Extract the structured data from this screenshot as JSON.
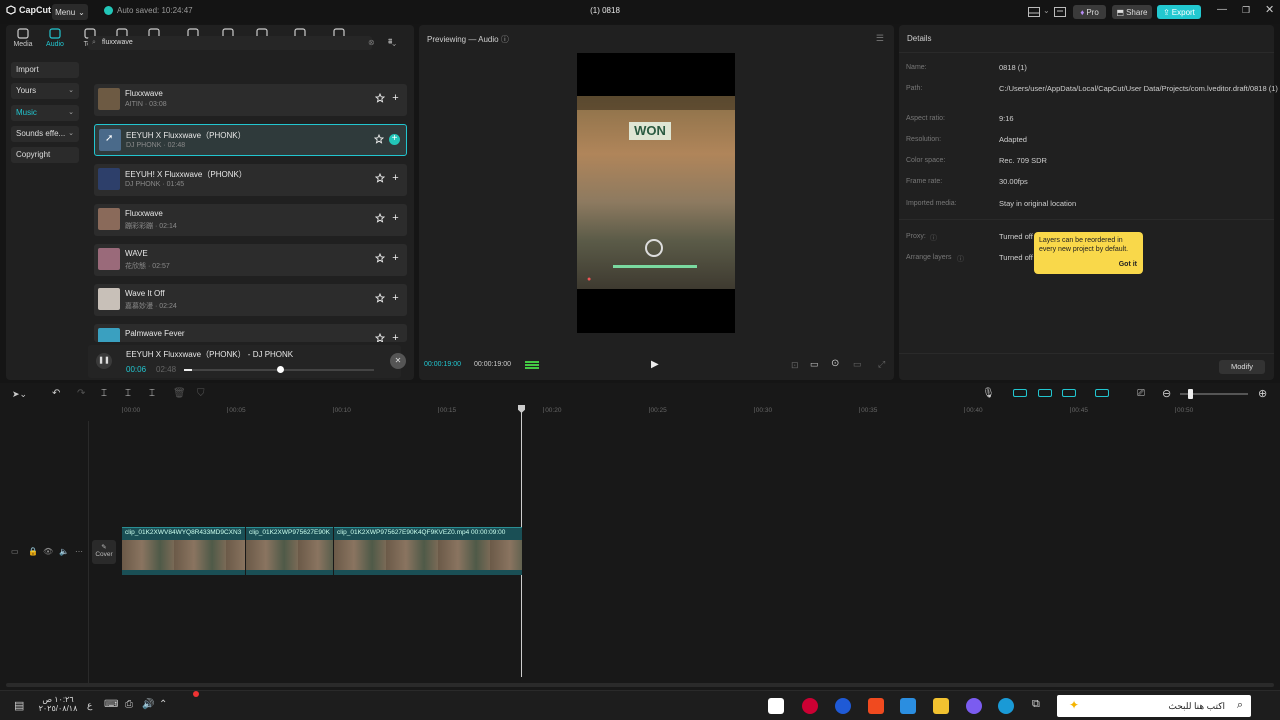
{
  "titlebar": {
    "app_name": "CapCut",
    "menu_label": "Menu",
    "autosave": "Auto saved: 10:24:47",
    "project_title": "(1) 0818",
    "pro_label": "Pro",
    "share_label": "Share",
    "export_label": "Export"
  },
  "toolbar": {
    "tabs": [
      {
        "label": "Media",
        "icon": "media-icon"
      },
      {
        "label": "Audio",
        "icon": "audio-icon",
        "active": true
      },
      {
        "label": "Text",
        "icon": "text-icon"
      },
      {
        "label": "Stickers",
        "icon": "stickers-icon"
      },
      {
        "label": "Effects",
        "icon": "effects-icon"
      },
      {
        "label": "Transitions",
        "icon": "transitions-icon"
      },
      {
        "label": "Captions",
        "icon": "captions-icon"
      },
      {
        "label": "Filters",
        "icon": "filters-icon"
      },
      {
        "label": "Adjustment",
        "icon": "adjustment-icon"
      },
      {
        "label": "AI avatar",
        "icon": "ai-avatar-icon"
      }
    ]
  },
  "sidebar": {
    "items": [
      {
        "label": "Import"
      },
      {
        "label": "Yours",
        "chevron": true
      },
      {
        "label": "Music",
        "chevron": true,
        "active": true
      },
      {
        "label": "Sounds effe...",
        "chevron": true
      },
      {
        "label": "Copyright"
      }
    ]
  },
  "search": {
    "value": "fluxxwave"
  },
  "tracks": [
    {
      "title": "Fluxxwave",
      "sub": "AITIN · 03:08",
      "color": "#6d5a43"
    },
    {
      "title": "EEYUH X Fluxxwave（PHONK）",
      "sub": "DJ PHONK · 02:48",
      "color": "#4a6a8a",
      "selected": true
    },
    {
      "title": "EEYUH! X Fluxxwave（PHONK）",
      "sub": "DJ PHONK · 01:45",
      "color": "#2d3f6a"
    },
    {
      "title": "Fluxxwave",
      "sub": "蹦彩彩蹦 · 02:14",
      "color": "#8a6a5a"
    },
    {
      "title": "WAVE",
      "sub": "花欣態 · 02:57",
      "color": "#9a6a7a"
    },
    {
      "title": "Wave It Off",
      "sub": "嘉慕妙漫 · 02:24",
      "color": "#c8c0b8"
    },
    {
      "title": "Palmwave Fever",
      "sub": "",
      "color": "#3aa0c0"
    }
  ],
  "player": {
    "title": "EEYUH X Fluxxwave（PHONK） - DJ PHONK",
    "current": "00:06",
    "total": "02:48",
    "progress": 0.04
  },
  "preview": {
    "title": "Previewing — Audio",
    "video_text": "WON",
    "time_current": "00:00:19:00",
    "time_total": "00:00:19:00"
  },
  "details": {
    "title": "Details",
    "rows": [
      {
        "label": "Name:",
        "value": "0818 (1)"
      },
      {
        "label": "Path:",
        "value": "C:/Users/user/AppData/Local/CapCut/User Data/Projects/com.lveditor.draft/0818 (1)"
      },
      {
        "label": "Aspect ratio:",
        "value": "9:16"
      },
      {
        "label": "Resolution:",
        "value": "Adapted"
      },
      {
        "label": "Color space:",
        "value": "Rec. 709 SDR"
      },
      {
        "label": "Frame rate:",
        "value": "30.00fps"
      },
      {
        "label": "Imported media:",
        "value": "Stay in original location"
      },
      {
        "label": "Proxy:",
        "value": "Turned off"
      },
      {
        "label": "Arrange layers",
        "value": "Turned off"
      }
    ],
    "modify_label": "Modify",
    "tooltip_text": "Layers can be reordered in every new project by default.",
    "tooltip_button": "Got it"
  },
  "timeline": {
    "ruler": [
      "00:00",
      "00:05",
      "00:10",
      "00:15",
      "00:20",
      "00:25",
      "00:30",
      "00:35",
      "00:40",
      "00:45",
      "00:50"
    ],
    "cover_label": "Cover",
    "clips": [
      {
        "name": "clip_01K2XWV84WYQ8R433MD9CXN3"
      },
      {
        "name": "clip_01K2XWP975627E90K"
      },
      {
        "name": "clip_01K2XWP975627E90K4QF9KVEZ0.mp4   00:00:09:00"
      }
    ]
  },
  "taskbar": {
    "time": "١٠:٢٦ ص",
    "date": "٢٠٢٥/٠٨/١٨",
    "search_placeholder": "اكتب هنا للبحث",
    "lang": "ع"
  }
}
